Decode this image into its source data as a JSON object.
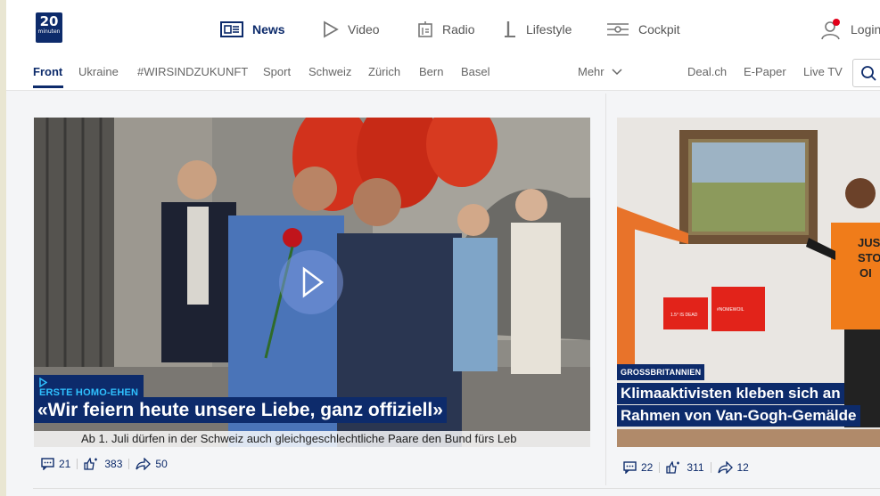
{
  "brand": {
    "logo_top": "20",
    "logo_bottom": "minuten"
  },
  "mainnav": [
    {
      "label": "News",
      "icon": "news-icon",
      "active": true
    },
    {
      "label": "Video",
      "icon": "play-icon",
      "active": false
    },
    {
      "label": "Radio",
      "icon": "radio-icon",
      "active": false
    },
    {
      "label": "Lifestyle",
      "icon": "lifestyle-icon",
      "active": false
    },
    {
      "label": "Cockpit",
      "icon": "cockpit-icon",
      "active": false
    }
  ],
  "login": {
    "label": "Login",
    "notification_color": "#e2001a"
  },
  "subnav": {
    "items": [
      "Front",
      "Ukraine",
      "#WIRSINDZUKUNFT",
      "Sport",
      "Schweiz",
      "Zürich",
      "Bern",
      "Basel"
    ],
    "more": "Mehr",
    "right": [
      "Deal.ch",
      "E-Paper",
      "Live TV"
    ]
  },
  "colors": {
    "brand": "#0d2b6b",
    "accent": "#2fc1ff"
  },
  "articles": [
    {
      "kicker": "ERSTE HOMO-EHEN",
      "headline": "«Wir feiern heute unsere Liebe, ganz offiziell»",
      "teaser": "Ab 1. Juli dürfen in der Schweiz auch gleichgeschlechtliche Paare den Bund fürs Leb",
      "is_video": true,
      "comments": "21",
      "likes": "383",
      "shares": "50"
    },
    {
      "kicker": "GROSSBRITANNIEN",
      "headline_line1": "Klimaaktivisten kleben sich an",
      "headline_line2": "Rahmen von Van-Gogh-Gemälde",
      "banner_text": "JUST STOP OIL",
      "sign1": "1.5° IS DEAD",
      "sign2": "#NOMEWOIL",
      "comments": "22",
      "likes": "311",
      "shares": "12"
    }
  ]
}
